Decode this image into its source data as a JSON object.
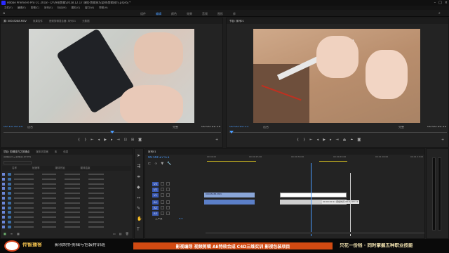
{
  "app": {
    "title": "Adobe Premiere Pro CC 2018 - D:\\外拍剪辑\\2018.12.17 课程-剪辑技巧案例\\剪辑技巧.prproj *",
    "menus": [
      "文件(F)",
      "编辑(E)",
      "剪辑(C)",
      "序列(S)",
      "标记(M)",
      "图形(G)",
      "窗口(W)",
      "帮助(H)"
    ],
    "workspaces": [
      "组件",
      "编辑",
      "颜色",
      "效果",
      "音频",
      "图形",
      "库"
    ],
    "active_workspace": "编辑"
  },
  "source_monitor": {
    "tabs": [
      "源: 00045288.MOV",
      "效果控件",
      "音频剪辑混合器: 序列01",
      "元数据"
    ],
    "timecode": "00:14:30:24",
    "fit": "适合",
    "scale": "完整",
    "duration": "00:00:22:19"
  },
  "program_monitor": {
    "tabs": [
      "节目: 序列01"
    ],
    "timecode": "00:00:00:11",
    "fit": "适合",
    "scale": "完整",
    "duration": "00:00:20:10"
  },
  "project_panel": {
    "tabs": [
      "项目: 剪辑技巧之剪辑点",
      "媒体浏览器",
      "库",
      "信息"
    ],
    "bin": "剪辑技巧之剪辑点.prproj",
    "columns": [
      "名称",
      "帧速率",
      "媒体开始",
      "媒体结束"
    ],
    "row_count": 12
  },
  "timeline": {
    "tab": "序列01",
    "timecode": "00:00:27:11",
    "ruler_marks": [
      "00:00:00",
      "00:00:15:00",
      "00:00:30:00",
      "00:00:45:00",
      "00:01:00:00",
      "00:01:15:00"
    ],
    "video_tracks": [
      "V3",
      "V2",
      "V1"
    ],
    "audio_tracks": [
      "A1",
      "A2",
      "A3"
    ],
    "master_label": "主声道",
    "master_value": "0.0",
    "clip_label": "00045288.MOV",
    "tooltip": "00:00:00:11 持续时间 00:00:03:12"
  },
  "footer": {
    "brand_name": "传智播客",
    "brand_sub": "影视制作剪辑与包装特训班",
    "banner": "影视编导  视频剪辑  AE特效合成  C4D三维实训  影视包装项目",
    "slogan": "只花一份钱 · 同时掌握五种职业技能"
  },
  "colors": {
    "accent": "#4a9cff",
    "banner": "#d14a12",
    "brand": "#f2c14e"
  }
}
